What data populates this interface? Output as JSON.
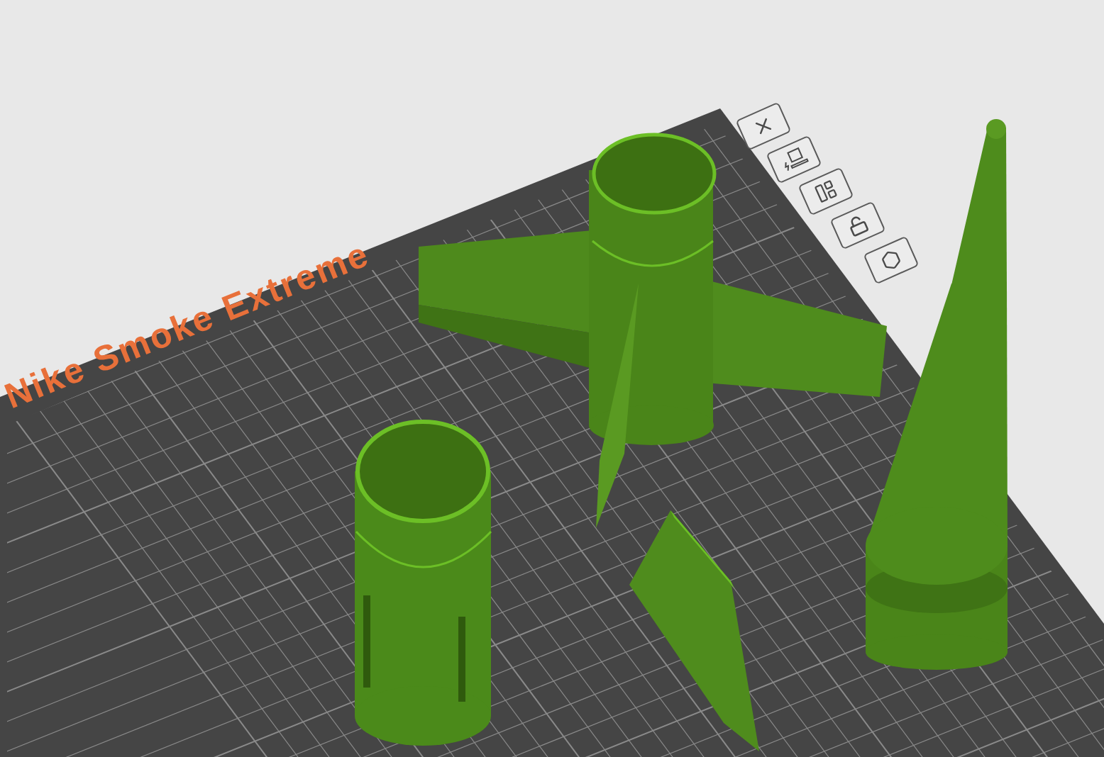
{
  "viewport": {
    "plate": {
      "name": "Nike Smoke Extreme",
      "buttons": [
        {
          "kind": "close"
        },
        {
          "kind": "auto-orient"
        },
        {
          "kind": "arrange"
        },
        {
          "kind": "unlock"
        },
        {
          "kind": "settings"
        }
      ]
    }
  }
}
